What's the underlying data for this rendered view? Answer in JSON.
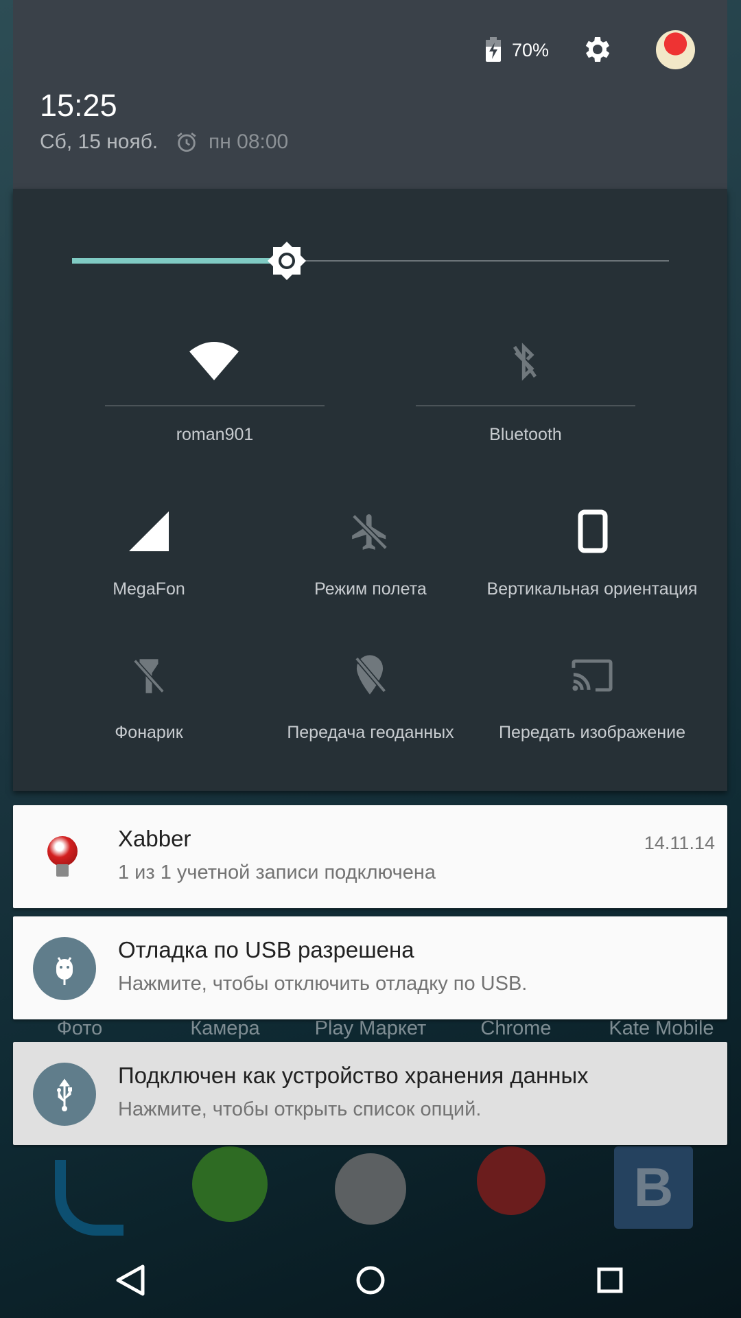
{
  "header": {
    "battery_percent": "70%",
    "battery_level": 70,
    "battery_charging": true,
    "time": "15:25",
    "date": "Сб, 15 нояб.",
    "alarm": "пн 08:00"
  },
  "brightness": {
    "level": 0.36,
    "accent": "#80cbc4"
  },
  "tiles_large": [
    {
      "label": "roman901",
      "icon": "wifi-icon",
      "active": true
    },
    {
      "label": "Bluetooth",
      "icon": "bluetooth-off-icon",
      "active": false
    }
  ],
  "tiles": [
    {
      "label": "MegaFon",
      "icon": "signal-icon",
      "active": true
    },
    {
      "label": "Режим полета",
      "icon": "airplane-icon",
      "active": false
    },
    {
      "label": "Вертикальная ориентация",
      "icon": "phone-portrait-icon",
      "active": true
    },
    {
      "label": "Фонарик",
      "icon": "flashlight-off-icon",
      "active": false
    },
    {
      "label": "Передача геоданных",
      "icon": "location-off-icon",
      "active": false
    },
    {
      "label": "Передать изображение",
      "icon": "cast-icon",
      "active": false
    }
  ],
  "notifications": [
    {
      "title": "Xabber",
      "text": "1 из 1 учетной записи подключена",
      "time": "14.11.14",
      "icon": "xabber-icon"
    },
    {
      "title": "Отладка по USB разрешена",
      "text": "Нажмите, чтобы отключить отладку по USB.",
      "icon": "android-debug-icon"
    },
    {
      "title": "Подключен как устройство хранения данных",
      "text": "Нажмите, чтобы открыть список опций.",
      "icon": "usb-icon"
    }
  ],
  "home_labels": [
    "Фото",
    "Камера",
    "Play Маркет",
    "Chrome",
    "Kate Mobile"
  ]
}
